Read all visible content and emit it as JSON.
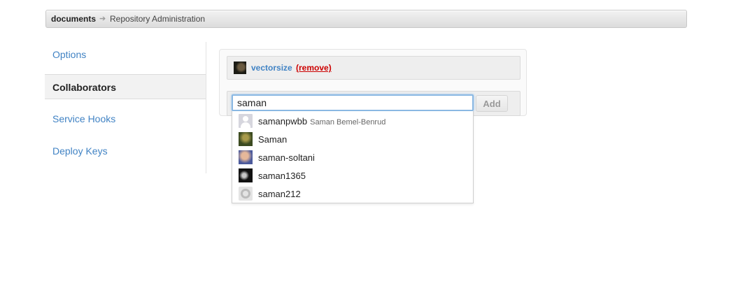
{
  "breadcrumb": {
    "repo": "documents",
    "separator": "➔",
    "page": "Repository Administration"
  },
  "sidebar": {
    "items": [
      {
        "label": "Options",
        "active": false
      },
      {
        "label": "Collaborators",
        "active": true
      },
      {
        "label": "Service Hooks",
        "active": false
      },
      {
        "label": "Deploy Keys",
        "active": false
      }
    ]
  },
  "collaborators": {
    "list": [
      {
        "login": "vectorsize",
        "remove_label": "(remove)"
      }
    ],
    "add_input_value": "saman",
    "add_button_label": "Add"
  },
  "suggestions": [
    {
      "login": "samanpwbb",
      "full_name": "Saman Bemel-Benrud",
      "avatar": "default-avatar-icon"
    },
    {
      "login": "Saman",
      "full_name": "",
      "avatar": "user-photo-avatar"
    },
    {
      "login": "saman-soltani",
      "full_name": "",
      "avatar": "user-photo-avatar"
    },
    {
      "login": "saman1365",
      "full_name": "",
      "avatar": "user-photo-avatar"
    },
    {
      "login": "saman212",
      "full_name": "",
      "avatar": "octocat-avatar-icon"
    }
  ],
  "colors": {
    "link": "#4183c4",
    "remove": "#cc0000",
    "focus_border": "#8ab8e3"
  }
}
